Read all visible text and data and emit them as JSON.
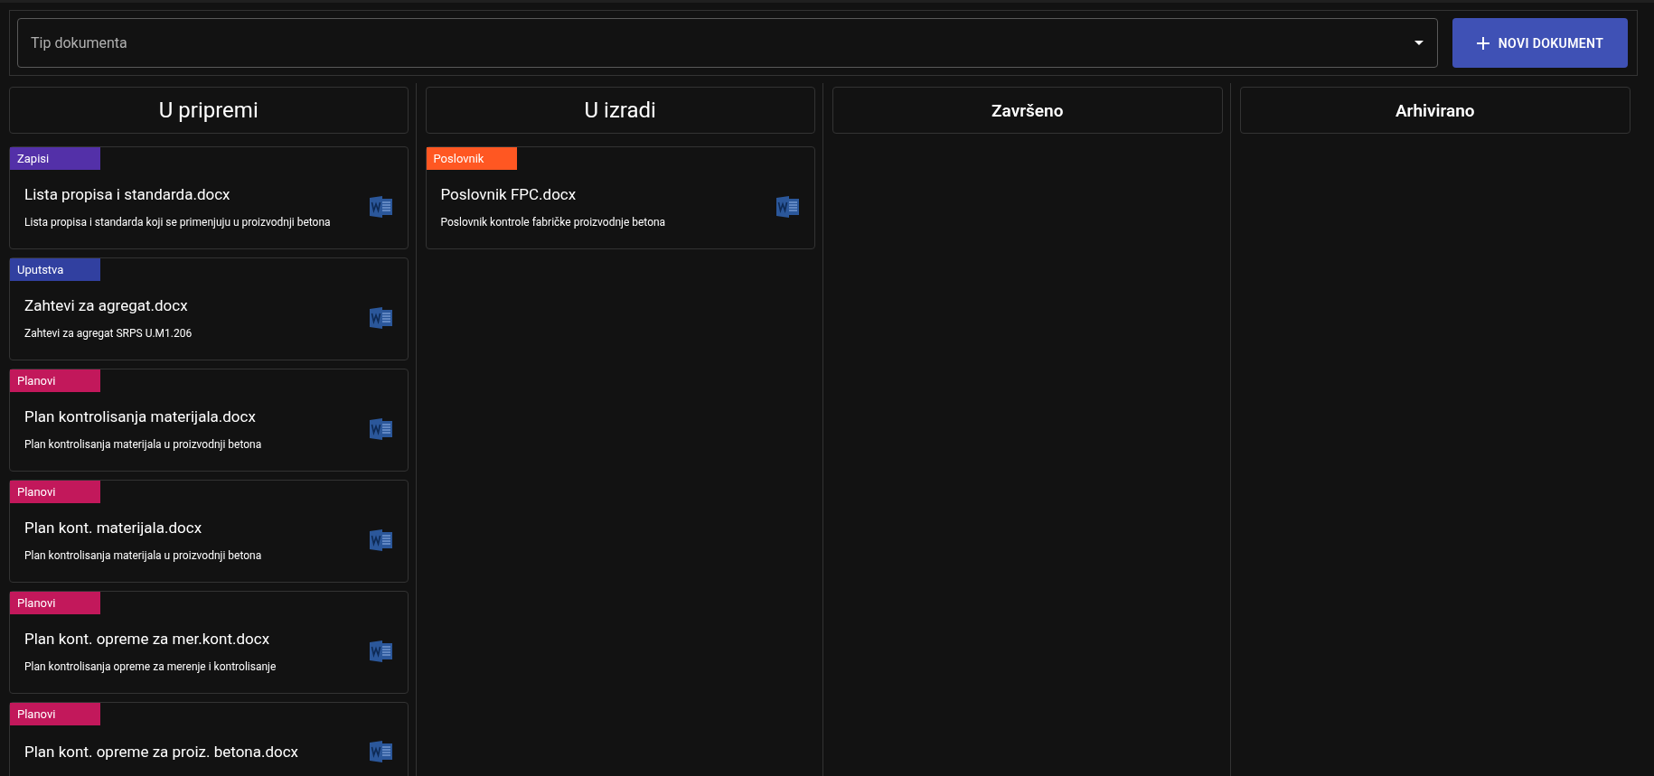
{
  "filter": {
    "placeholder": "Tip dokumenta"
  },
  "new_button": {
    "label": "NOVI DOKUMENT"
  },
  "columns": [
    {
      "title": "U pripremi",
      "cards": [
        {
          "tag": "Zapisi",
          "color": "#5330a8",
          "title": "Lista propisa i standarda.docx",
          "description": "Lista propisa i standarda koji se primenjuju u proizvodnji betona"
        },
        {
          "tag": "Uputstva",
          "color": "#3140a0",
          "title": "Zahtevi za agregat.docx",
          "description": "Zahtevi za agregat SRPS U.M1.206"
        },
        {
          "tag": "Planovi",
          "color": "#c2185b",
          "title": "Plan kontrolisanja materijala.docx",
          "description": "Plan kontrolisanja materijala u proizvodnji betona"
        },
        {
          "tag": "Planovi",
          "color": "#c2185b",
          "title": "Plan kont. materijala.docx",
          "description": "Plan kontrolisanja materijala u proizvodnji betona"
        },
        {
          "tag": "Planovi",
          "color": "#c2185b",
          "title": "Plan kont. opreme za mer.kont.docx",
          "description": "Plan kontrolisanja opreme za merenje i kontrolisanje"
        },
        {
          "tag": "Planovi",
          "color": "#c2185b",
          "title": "Plan kont. opreme za proiz. betona.docx"
        }
      ]
    },
    {
      "title": "U izradi",
      "cards": [
        {
          "tag": "Poslovnik",
          "color": "#ff5722",
          "title": "Poslovnik FPC.docx",
          "description": "Poslovnik kontrole fabričke proizvodnje betona"
        }
      ]
    },
    {
      "title": "Završeno"
    },
    {
      "title": "Arhivirano"
    }
  ]
}
